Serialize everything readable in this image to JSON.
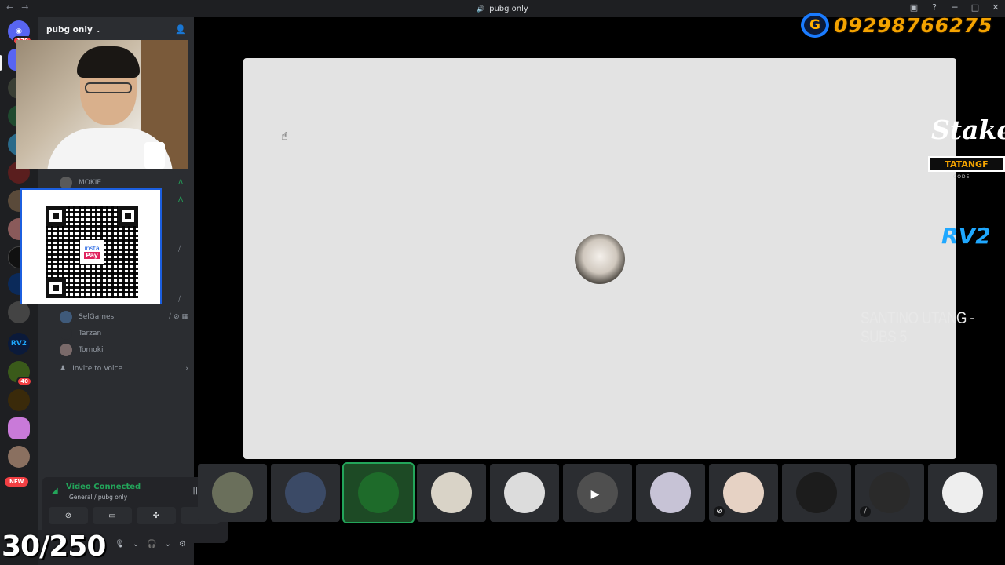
{
  "window": {
    "title": "pubg only",
    "channel_glyph": "🔊"
  },
  "server": {
    "name": "pubg only",
    "rail_badges": {
      "home": "179",
      "guild_a": "40"
    },
    "new_label": "NEW"
  },
  "voice": {
    "members": [
      {
        "name": "MOKIE"
      },
      {
        "name": "SelGames"
      },
      {
        "name": "Tarzan"
      },
      {
        "name": "Tomoki"
      }
    ],
    "invite_label": "Invite to Voice"
  },
  "qr": {
    "brand_top": "insta",
    "brand_bottom": "Pay"
  },
  "connection": {
    "status": "Video Connected",
    "subtitle": "General / pubg only"
  },
  "overlay": {
    "count": "30/250",
    "phone": "09298766275",
    "phone_logo": "G",
    "stake_brand": "Stake",
    "stake_code": "TATANGF",
    "stake_code_label": "CODE",
    "rv2": "RV2",
    "subs_line": "SANTINO UTANG - SUBS 5"
  },
  "tiles": [
    {
      "color": "#6a6f5b",
      "active": false,
      "icon": ""
    },
    {
      "color": "#3b4a66",
      "active": false,
      "icon": ""
    },
    {
      "color": "#1e6b2a",
      "active": true,
      "icon": ""
    },
    {
      "color": "#d9d3c7",
      "active": false,
      "icon": ""
    },
    {
      "color": "#dcdcdc",
      "active": false,
      "icon": ""
    },
    {
      "color": "#4f4f4f",
      "active": false,
      "icon": "video-icon"
    },
    {
      "color": "#c7c3d6",
      "active": false,
      "icon": ""
    },
    {
      "color": "#e6d2c4",
      "active": false,
      "icon": "mute-icon"
    },
    {
      "color": "#1c1c1c",
      "active": false,
      "icon": ""
    },
    {
      "color": "#2a2a2a",
      "active": false,
      "icon": "mic-off-icon"
    },
    {
      "color": "#eeeeee",
      "active": false,
      "icon": ""
    }
  ],
  "colors": {
    "accent_green": "#23a55a",
    "brand_blurple": "#5865f2",
    "danger_red": "#f23f43",
    "overlay_orange": "#f4a300"
  }
}
